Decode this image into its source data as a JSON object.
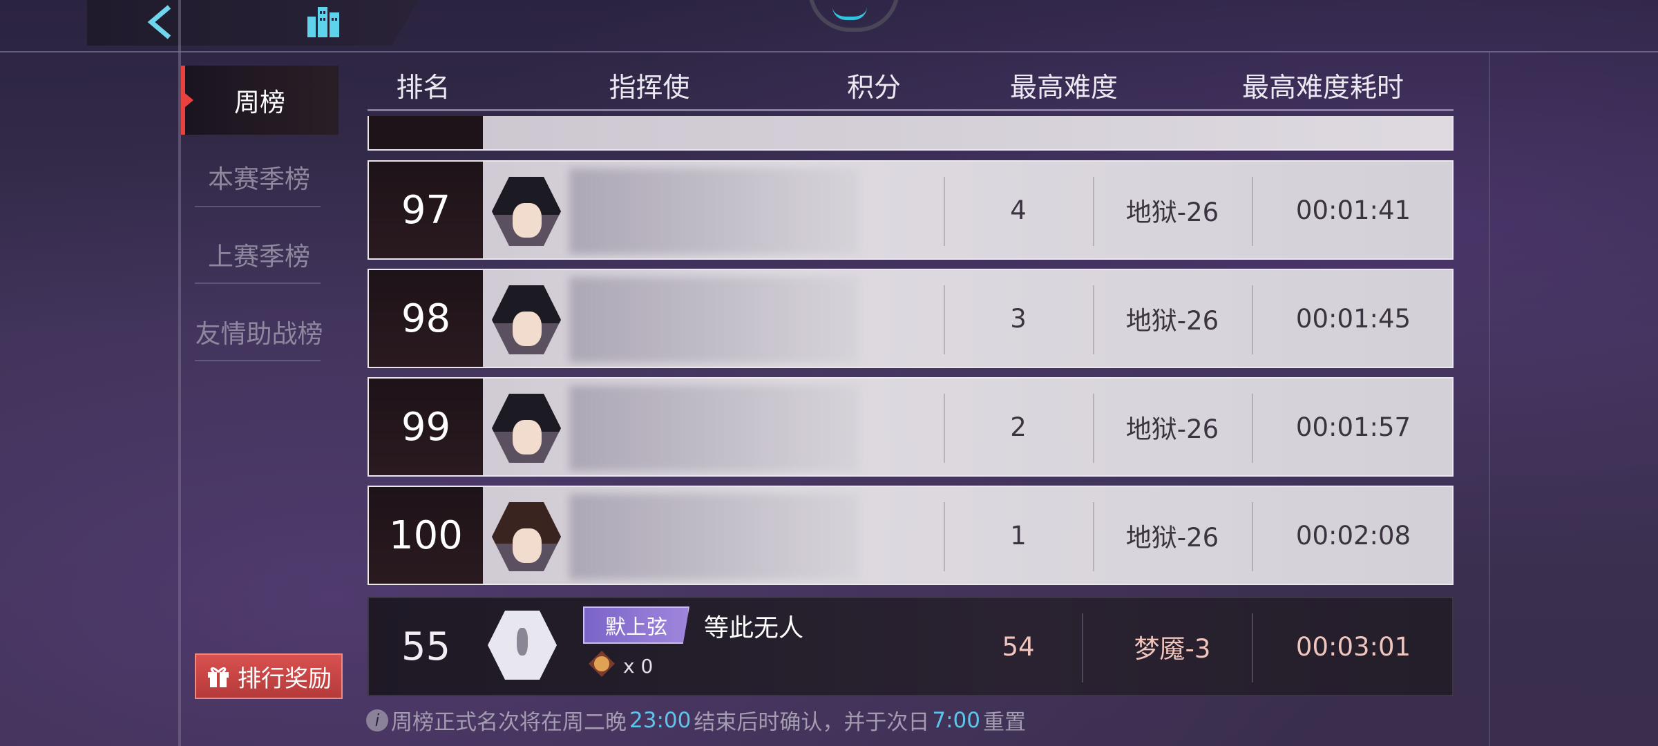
{
  "nav": {
    "back_icon": "back-arrow-icon",
    "home_icon": "building-icon"
  },
  "sidebar": {
    "tabs": [
      {
        "label": "周榜"
      },
      {
        "label": "本赛季榜"
      },
      {
        "label": "上赛季榜"
      },
      {
        "label": "友情助战榜"
      }
    ],
    "reward_button": "排行奖励"
  },
  "table": {
    "headers": [
      "排名",
      "指挥使",
      "积分",
      "最高难度",
      "最高难度耗时"
    ],
    "rows": [
      {
        "rank": "97",
        "score": "4",
        "difficulty": "地狱-26",
        "time": "00:01:41"
      },
      {
        "rank": "98",
        "score": "3",
        "difficulty": "地狱-26",
        "time": "00:01:45"
      },
      {
        "rank": "99",
        "score": "2",
        "difficulty": "地狱-26",
        "time": "00:01:57"
      },
      {
        "rank": "100",
        "score": "1",
        "difficulty": "地狱-26",
        "time": "00:02:08"
      }
    ],
    "my_row": {
      "rank": "55",
      "title": "默上弦",
      "name": "等此无人",
      "item_count": "x 0",
      "score": "54",
      "difficulty": "梦魇-3",
      "time": "00:03:01"
    }
  },
  "footer": {
    "part1": "周榜正式名次将在周二晚 ",
    "time1": "23:00",
    "part2": "结束后时确认，并于次日 ",
    "time2": "7:00",
    "part3": " 重置"
  },
  "colors": {
    "accent_red": "#e8413e",
    "badge_purple": "#8f76d4",
    "time_cyan": "#5fc4ea"
  }
}
